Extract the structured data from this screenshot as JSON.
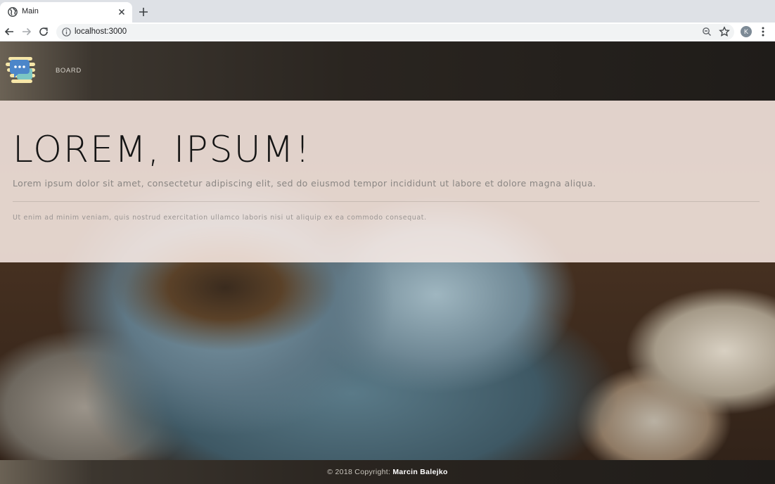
{
  "browser": {
    "tab_title": "Main",
    "url": "localhost:3000",
    "profile_initial": "K"
  },
  "navbar": {
    "link_label": "BOARD"
  },
  "jumbotron": {
    "title": "LOREM, IPSUM!",
    "lead": "Lorem ipsum dolor sit amet, consectetur adipiscing elit, sed do eiusmod tempor incididunt ut labore et dolore magna aliqua.",
    "text": "Ut enim ad minim veniam, quis nostrud exercitation ullamco laboris nisi ut aliquip ex ea commodo consequat."
  },
  "footer": {
    "copyright": "© 2018 Copyright:",
    "author": "Marcin Balejko"
  }
}
